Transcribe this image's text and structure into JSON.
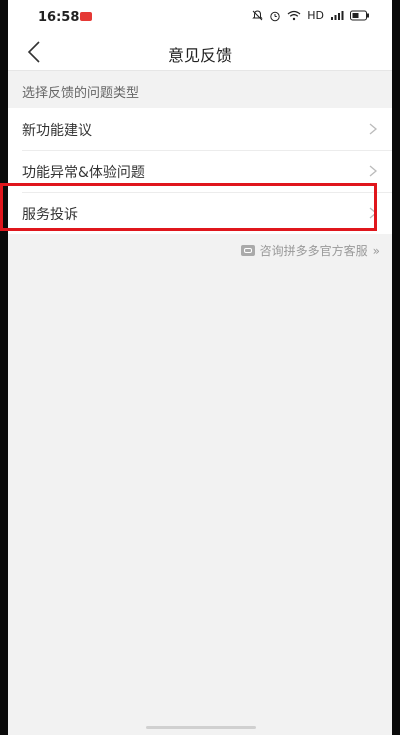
{
  "status_bar": {
    "time": "16:58",
    "network_label": "HD",
    "battery_icon": "battery-icon",
    "wifi_icon": "wifi-icon",
    "alarm_icon": "alarm-icon",
    "bell_off_icon": "bell-off-icon",
    "signal_icon": "signal-icon"
  },
  "header": {
    "title": "意见反馈",
    "back_icon": "chevron-left-icon"
  },
  "section": {
    "title": "选择反馈的问题类型"
  },
  "items": [
    {
      "label": "新功能建议"
    },
    {
      "label": "功能异常&体验问题"
    },
    {
      "label": "服务投诉",
      "highlighted": true
    }
  ],
  "consult": {
    "label": "咨询拼多多官方客服",
    "suffix": "»"
  },
  "colors": {
    "highlight": "#e0161c",
    "background": "#f2f2f2",
    "surface": "#ffffff"
  }
}
